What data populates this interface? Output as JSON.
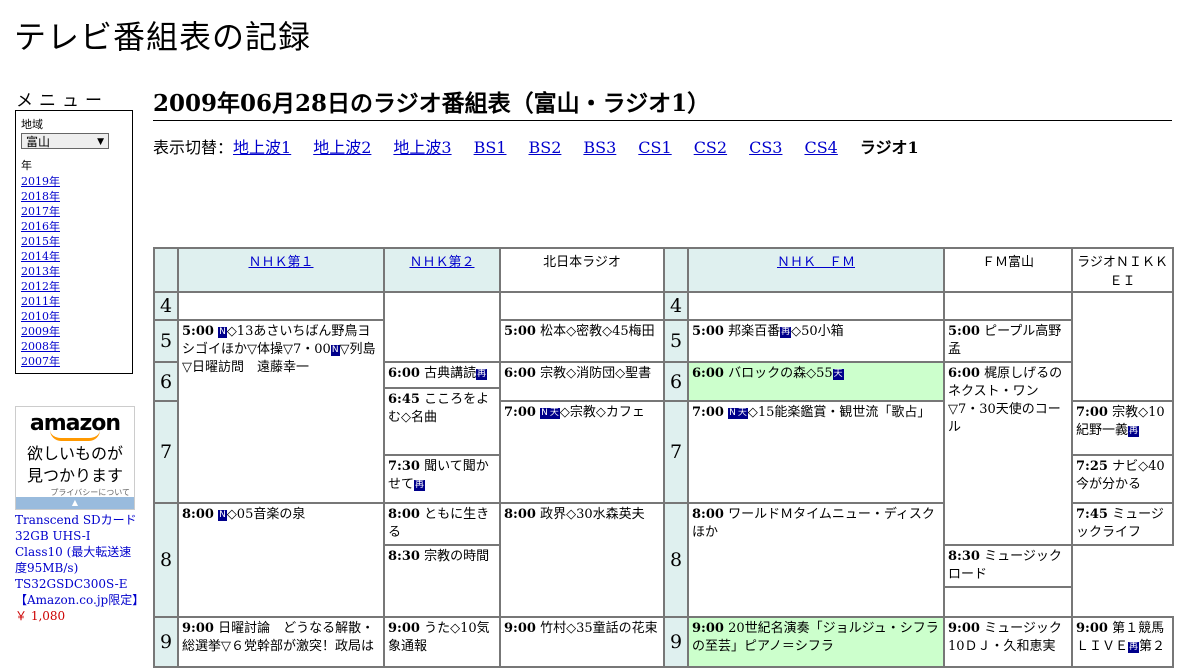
{
  "site_title": "テレビ番組表の記録",
  "menu": {
    "title": "メニュー",
    "region_label": "地域",
    "region_value": "富山",
    "year_label": "年",
    "years": [
      "2019年",
      "2018年",
      "2017年",
      "2016年",
      "2015年",
      "2014年",
      "2013年",
      "2012年",
      "2011年",
      "2010年",
      "2009年",
      "2008年",
      "2007年"
    ]
  },
  "ad": {
    "logo": "amazon",
    "tagline1": "欲しいものが",
    "tagline2": "見つかります",
    "privacy": "プライバシーについて",
    "product": "Transcend SDカード 32GB UHS-I Class10 (最大転送速度95MB/s) TS32GSDC300S-E【Amazon.co.jp限定】",
    "price": "￥ 1,080"
  },
  "heading": "2009年06月28日のラジオ番組表（富山・ラジオ1）",
  "switch": {
    "label": "表示切替：",
    "links": [
      "地上波1",
      "地上波2",
      "地上波3",
      "BS1",
      "BS2",
      "BS3",
      "CS1",
      "CS2",
      "CS3",
      "CS4"
    ],
    "current": "ラジオ1"
  },
  "channels": [
    "ＮＨＫ第１",
    "ＮＨＫ第２",
    "北日本ラジオ",
    "ＮＨＫ　ＦＭ",
    "ＦＭ富山",
    "ラジオＮＩＫＫＥＩ"
  ],
  "hours": [
    "4",
    "5",
    "6",
    "7",
    "8",
    "9"
  ],
  "programs": {
    "nhk1_5": {
      "time": "5:00",
      "title": "◇13あさいちばん野鳥ヨシゴイほか▽体操▽7・00",
      "title2": "▽列島▽日曜訪問　遠藤幸一"
    },
    "nhk1_8": {
      "time": "8:00",
      "title": "◇05音楽の泉"
    },
    "nhk1_9": {
      "time": "9:00",
      "title": "日曜討論　どうなる解散・総選挙▽６党幹部が激突！政局は"
    },
    "nhk2_600": {
      "time": "6:00",
      "title": "古典講読"
    },
    "nhk2_645": {
      "time": "6:45",
      "title": "こころをよむ◇名曲"
    },
    "nhk2_730": {
      "time": "7:30",
      "title": "聞いて聞かせて"
    },
    "nhk2_800": {
      "time": "8:00",
      "title": "ともに生きる"
    },
    "nhk2_830": {
      "time": "8:30",
      "title": "宗教の時間"
    },
    "nhk2_900": {
      "time": "9:00",
      "title": "うた◇10気象通報"
    },
    "knb_500": {
      "time": "5:00",
      "title": "松本◇密教◇45梅田"
    },
    "knb_600": {
      "time": "6:00",
      "title": "宗教◇消防団◇聖書"
    },
    "knb_700": {
      "time": "7:00",
      "title": "◇宗教◇カフェ"
    },
    "knb_800": {
      "time": "8:00",
      "title": "政界◇30水森英夫"
    },
    "knb_900": {
      "time": "9:00",
      "title": "竹村◇35童話の花束"
    },
    "fm_500": {
      "time": "5:00",
      "title": "邦楽百番",
      "title2": "◇50小箱"
    },
    "fm_600": {
      "time": "6:00",
      "title": "バロックの森◇55"
    },
    "fm_700": {
      "time": "7:00",
      "title": "◇15能楽鑑賞・観世流「歌占」"
    },
    "fm_800": {
      "time": "8:00",
      "title": "ワールドＭタイムニュー・ディスクほか"
    },
    "fm_900": {
      "time": "9:00",
      "title": "20世紀名演奏「ジョルジュ・シフラの至芸」ピアノ＝シフラ"
    },
    "fmt_500": {
      "time": "5:00",
      "title": "ピープル高野孟"
    },
    "fmt_600": {
      "time": "6:00",
      "title": "梶原しげるのネクスト・ワン▽7・30天使のコール"
    },
    "fmt_900": {
      "time": "9:00",
      "title": "ミュージック10ＤＪ・久和恵実"
    },
    "nikkei_700": {
      "time": "7:00",
      "title": "宗教◇10紀野一義"
    },
    "nikkei_725": {
      "time": "7:25",
      "title": "ナビ◇40今が分かる"
    },
    "nikkei_745": {
      "time": "7:45",
      "title": "ミュージックライフ"
    },
    "nikkei_830": {
      "time": "8:30",
      "title": "ミュージックロード"
    },
    "nikkei_900": {
      "time": "9:00",
      "title": "第１競馬ＬＩＶＥ",
      "title2": "第２"
    }
  },
  "icons": {
    "news": "N",
    "stereo": "天",
    "rerun": "再"
  },
  "colors": {
    "header_bg": "#dff0ef",
    "highlight": "#ccffcc",
    "icon_bg": "#00008b",
    "link": "#0000cc"
  }
}
